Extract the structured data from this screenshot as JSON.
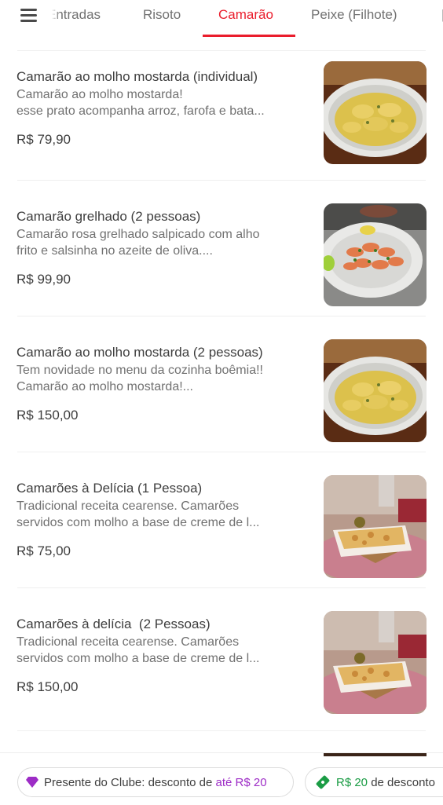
{
  "tabs": [
    {
      "label": "Entradas",
      "active": false
    },
    {
      "label": "Risoto",
      "active": false
    },
    {
      "label": "Camarão",
      "active": true
    },
    {
      "label": "Peixe (Filhote)",
      "active": false
    }
  ],
  "items": [
    {
      "title": "Camarão ao molho mostarda (individual)",
      "desc_lines": [
        "Camarão ao molho mostarda!",
        "esse prato acompanha arroz, farofa e bata..."
      ],
      "price": "R$ 79,90",
      "image": "shrimp-mustard-sauce-plate"
    },
    {
      "title": "Camarão grelhado (2 pessoas)",
      "desc_lines": [
        "Camarão rosa grelhado salpicado com alho",
        "frito e salsinha no azeite de oliva...."
      ],
      "price": "R$ 99,90",
      "image": "grilled-shrimp-plate"
    },
    {
      "title": "Camarão ao molho mostarda (2 pessoas)",
      "desc_lines": [
        "Tem novidade no menu da cozinha boêmia!!",
        "Camarão ao molho mostarda!..."
      ],
      "price": "R$ 150,00",
      "image": "shrimp-mustard-sauce-plate"
    },
    {
      "title": "Camarões à Delícia (1 Pessoa)",
      "desc_lines": [
        "Tradicional receita cearense. Camarões",
        "servidos com molho a base de creme de l..."
      ],
      "price": "R$ 75,00",
      "image": "shrimp-gratin-dish"
    },
    {
      "title": "Camarões à delícia  (2 Pessoas)",
      "desc_lines": [
        "Tradicional receita cearense. Camarões",
        "servidos com molho a base de creme de l..."
      ],
      "price": "R$ 150,00",
      "image": "shrimp-gratin-dish"
    }
  ],
  "promos": {
    "club": {
      "prefix": "Presente do Clube: desconto de",
      "highlight": "até R$ 20",
      "icon": "purple-diamond-icon"
    },
    "discount": {
      "highlight": "R$ 20",
      "suffix": "de desconto",
      "icon": "green-ticket-icon"
    }
  },
  "colors": {
    "accent": "#ea1d2c",
    "club_purple": "#9d2cc6",
    "discount_green": "#1b9c45"
  }
}
